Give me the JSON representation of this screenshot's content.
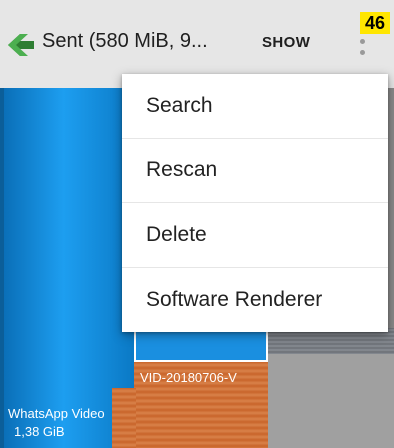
{
  "appbar": {
    "title": "Sent (580 MiB, 9...",
    "show_label": "SHOW",
    "icons": {
      "app": "app-logo-icon",
      "overflow": "more-vert-icon"
    }
  },
  "badge": "46",
  "menu": {
    "items": [
      {
        "label": "Search"
      },
      {
        "label": "Rescan"
      },
      {
        "label": "Delete"
      },
      {
        "label": "Software Renderer"
      }
    ]
  },
  "treemap": {
    "tiles": [
      {
        "name": "VID-20180706-V"
      },
      {
        "name": "WhatsApp Video",
        "size": "1,38 GiB"
      }
    ]
  },
  "colors": {
    "appbar": "#e6e6e6",
    "accent_green": "#2e7d32",
    "tile_blue": "#1d9ef0",
    "tile_orange": "#d9824a",
    "badge": "#ffe600"
  }
}
